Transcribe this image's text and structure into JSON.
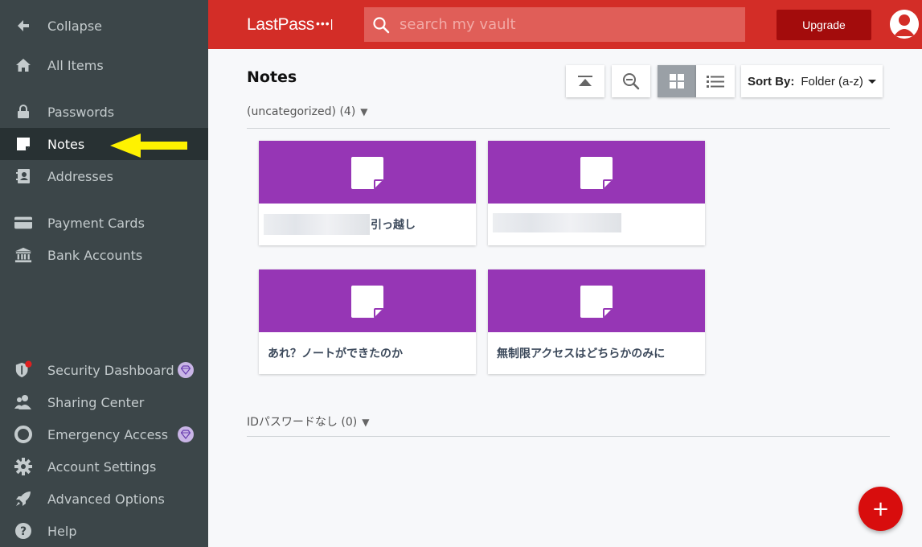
{
  "sidebar": {
    "collapse": "Collapse",
    "all_items": "All Items",
    "passwords": "Passwords",
    "notes": "Notes",
    "addresses": "Addresses",
    "payment_cards": "Payment Cards",
    "bank_accounts": "Bank Accounts",
    "security_dashboard": "Security Dashboard",
    "sharing_center": "Sharing Center",
    "emergency_access": "Emergency Access",
    "account_settings": "Account Settings",
    "advanced_options": "Advanced Options",
    "help": "Help"
  },
  "header": {
    "logo": "LastPass",
    "logo_dots": "•••|",
    "search_placeholder": "search my vault",
    "upgrade_label": "Upgrade"
  },
  "main": {
    "title": "Notes",
    "sort_label": "Sort By:",
    "sort_value": "Folder (a-z)",
    "folders": [
      {
        "label": "(uncategorized) (4)",
        "notes": [
          {
            "name": "引っ越し"
          },
          {
            "name": ""
          },
          {
            "name": "あれ？ノートができたのか"
          },
          {
            "name": "無制限アクセスはどちらかのみに"
          }
        ]
      },
      {
        "label": "IDパスワードなし (0)",
        "notes": []
      }
    ],
    "add_label": "+"
  },
  "colors": {
    "sidebar_bg": "#3c4649",
    "sidebar_active_bg": "#283133",
    "header_red": "#d32d27",
    "upgrade_bg": "#a30c0c",
    "note_purple": "#9636b5",
    "fab_red": "#d80d0d",
    "annotation_yellow": "#fff200"
  }
}
